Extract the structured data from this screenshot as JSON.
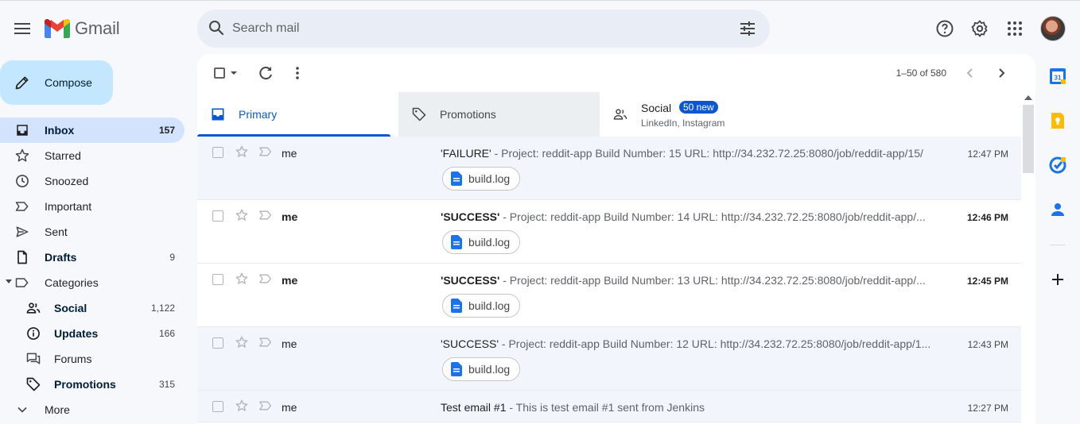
{
  "app": {
    "name": "Gmail"
  },
  "search": {
    "placeholder": "Search mail"
  },
  "compose": {
    "label": "Compose"
  },
  "nav": {
    "items": [
      {
        "label": "Inbox",
        "count": "157"
      },
      {
        "label": "Starred",
        "count": ""
      },
      {
        "label": "Snoozed",
        "count": ""
      },
      {
        "label": "Important",
        "count": ""
      },
      {
        "label": "Sent",
        "count": ""
      },
      {
        "label": "Drafts",
        "count": "9"
      },
      {
        "label": "Categories",
        "count": ""
      },
      {
        "label": "Social",
        "count": "1,122"
      },
      {
        "label": "Updates",
        "count": "166"
      },
      {
        "label": "Forums",
        "count": ""
      },
      {
        "label": "Promotions",
        "count": "315"
      },
      {
        "label": "More",
        "count": ""
      }
    ]
  },
  "toolbar": {
    "pager": "1–50 of 580"
  },
  "tabs": {
    "primary": "Primary",
    "promotions": "Promotions",
    "social": "Social",
    "social_badge": "50 new",
    "social_sub": "LinkedIn, Instagram"
  },
  "emails": [
    {
      "sender": "me",
      "subject": "'FAILURE'",
      "snippet": " - Project: reddit-app Build Number: 15 URL: http://34.232.72.25:8080/job/reddit-app/15/",
      "time": "12:47 PM",
      "attachment": "build.log"
    },
    {
      "sender": "me",
      "subject": "'SUCCESS'",
      "snippet": " - Project: reddit-app Build Number: 14 URL: http://34.232.72.25:8080/job/reddit-app/...",
      "time": "12:46 PM",
      "attachment": "build.log"
    },
    {
      "sender": "me",
      "subject": "'SUCCESS'",
      "snippet": " - Project: reddit-app Build Number: 13 URL: http://34.232.72.25:8080/job/reddit-app/...",
      "time": "12:45 PM",
      "attachment": "build.log"
    },
    {
      "sender": "me",
      "subject": "'SUCCESS'",
      "snippet": " - Project: reddit-app Build Number: 12 URL: http://34.232.72.25:8080/job/reddit-app/1...",
      "time": "12:43 PM",
      "attachment": "build.log"
    },
    {
      "sender": "me",
      "subject": "Test email #1",
      "snippet": " - This is test email #1 sent from Jenkins",
      "time": "12:27 PM",
      "attachment": ""
    }
  ],
  "colors": {
    "accent": "#0b57d0",
    "compose_bg": "#c2e7ff",
    "active_nav": "#d3e3fd",
    "page_bg": "#f6f8fc"
  }
}
